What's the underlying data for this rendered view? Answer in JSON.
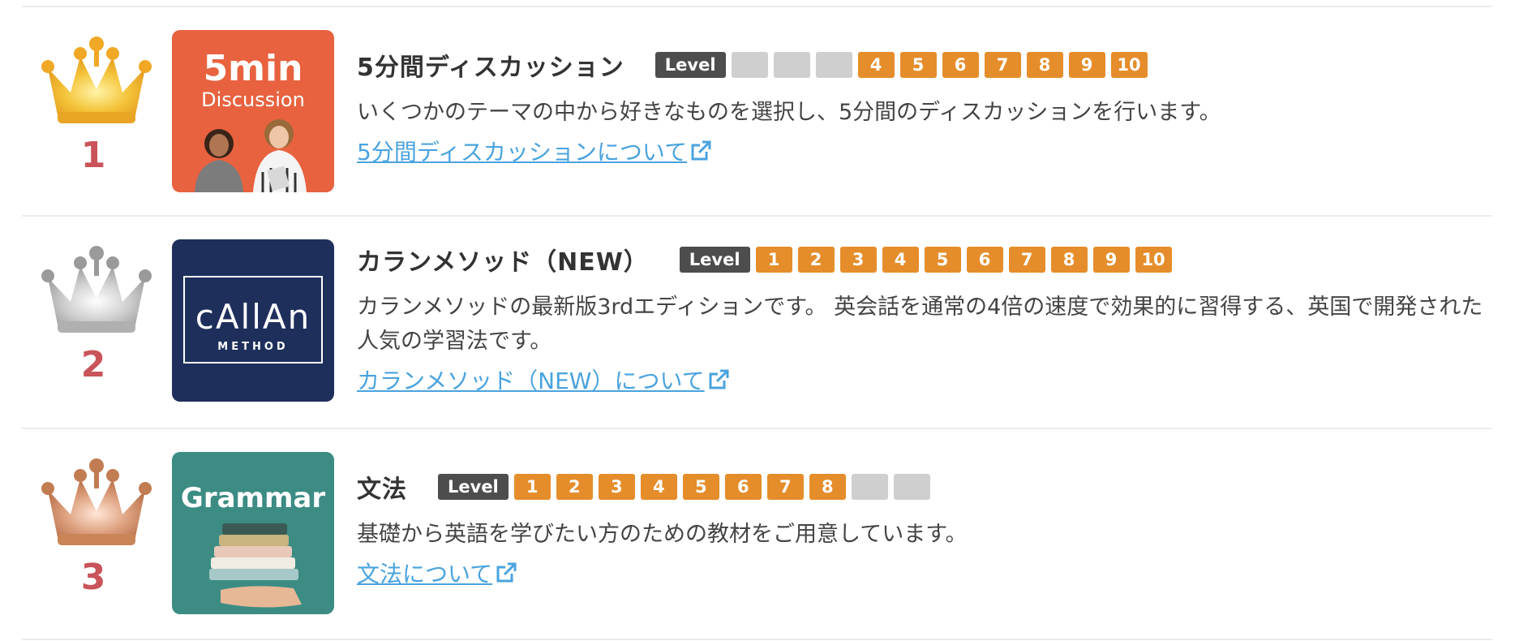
{
  "items": [
    {
      "rank": "1",
      "crown_color": "gold",
      "title": "5分間ディスカッション",
      "level_label": "Level",
      "levels": [
        "",
        "",
        "",
        "4",
        "5",
        "6",
        "7",
        "8",
        "9",
        "10"
      ],
      "description": "いくつかのテーマの中から好きなものを選択し、5分間のディスカッションを行います。",
      "link_text": "5分間ディスカッションについて",
      "thumb": {
        "line1": "5min",
        "line2": "Discussion",
        "bg": "#e8623f"
      }
    },
    {
      "rank": "2",
      "crown_color": "silver",
      "title": "カランメソッド（NEW）",
      "level_label": "Level",
      "levels": [
        "1",
        "2",
        "3",
        "4",
        "5",
        "6",
        "7",
        "8",
        "9",
        "10"
      ],
      "description": "カランメソッドの最新版3rdエディションです。 英会話を通常の4倍の速度で効果的に習得する、英国で開発された人気の学習法です。",
      "link_text": "カランメソッド（NEW）について",
      "thumb": {
        "line1": "cAllAn",
        "line2": "METHOD",
        "bg": "#1f2f5c"
      }
    },
    {
      "rank": "3",
      "crown_color": "bronze",
      "title": "文法",
      "level_label": "Level",
      "levels": [
        "1",
        "2",
        "3",
        "4",
        "5",
        "6",
        "7",
        "8",
        "",
        ""
      ],
      "description": "基礎から英語を学びたい方のための教材をご用意しています。",
      "link_text": "文法について",
      "thumb": {
        "line1": "Grammar",
        "bg": "#3c8c84"
      }
    }
  ],
  "colors": {
    "level_active": "#e58d2b",
    "level_inactive": "#cfcfcf",
    "level_label_bg": "#4d4d4d",
    "rank_number": "#c9545a",
    "link": "#4aa3df",
    "gold": "#f2b733",
    "silver": "#bdbdbd",
    "bronze": "#d9906a"
  }
}
